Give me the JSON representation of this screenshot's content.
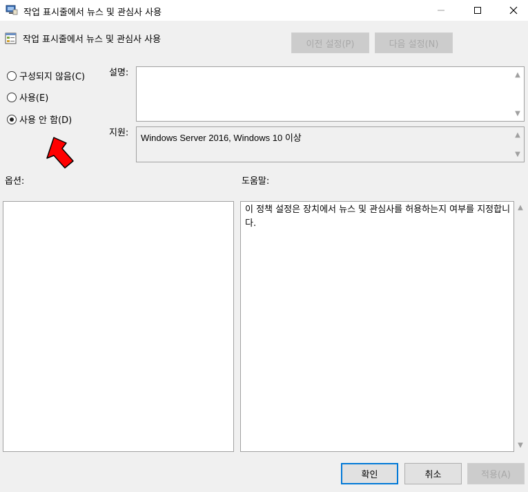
{
  "window": {
    "title": "작업 표시줄에서 뉴스 및 관심사 사용",
    "icon": "group-policy-icon",
    "controls": {
      "minimize": "—",
      "maximize": "☐",
      "close": "✕"
    }
  },
  "header": {
    "title": "작업 표시줄에서 뉴스 및 관심사 사용",
    "icon": "policy-setting-icon",
    "prev_button": "이전 설정(P)",
    "next_button": "다음 설정(N)"
  },
  "state_options": [
    {
      "label": "구성되지 않음(C)",
      "checked": false
    },
    {
      "label": "사용(E)",
      "checked": false
    },
    {
      "label": "사용 안 함(D)",
      "checked": true
    }
  ],
  "comment": {
    "label": "설명:",
    "value": ""
  },
  "supported": {
    "label": "지원:",
    "value": "Windows Server 2016, Windows 10 이상"
  },
  "options": {
    "label": "옵션:"
  },
  "help": {
    "label": "도움말:",
    "text": "이 정책 설정은 장치에서 뉴스 및 관심사를 허용하는지 여부를 지정합니다."
  },
  "footer": {
    "ok": "확인",
    "cancel": "취소",
    "apply": "적용(A)"
  },
  "annotation": {
    "icon": "red-arrow-icon",
    "color": "#ff0000"
  },
  "colors": {
    "accent": "#0078d7",
    "window_bg": "#f0f0f0"
  }
}
